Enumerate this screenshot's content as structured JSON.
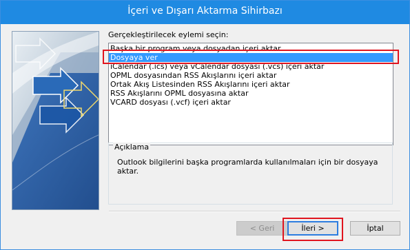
{
  "window": {
    "title": "İçeri ve Dışarı Aktarma Sihirbazı"
  },
  "wizard": {
    "prompt": "Gerçekleştirilecek eylemi seçin:",
    "actions": [
      "Başka bir program veya dosyadan içeri aktar",
      "Dosyaya ver",
      "iCalendar (.ics) veya vCalendar dosyası (.vcs) içeri aktar",
      "OPML dosyasından RSS Akışlarını içeri aktar",
      "Ortak Akış Listesinden RSS Akışlarını içeri aktar",
      "RSS Akışlarını OPML dosyasına aktar",
      "VCARD dosyası (.vcf) içeri aktar"
    ],
    "selected_action": "Dosyaya ver",
    "description_label": "Açıklama",
    "description_text": "Outlook bilgilerini başka programlarda kullanılmaları için bir dosyaya aktar."
  },
  "buttons": {
    "back": "< Geri",
    "next": "İleri >",
    "cancel": "İptal"
  },
  "colors": {
    "titlebar": "#1f8ae2",
    "selection": "#3399ff",
    "highlight_box": "#e0141e"
  }
}
